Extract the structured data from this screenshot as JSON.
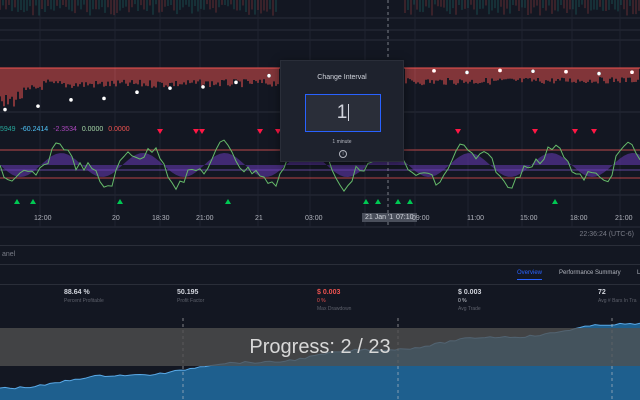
{
  "chart": {
    "indicator_values": [
      "5949",
      "-60.2414",
      "-2.3534",
      "0.0000",
      "0.0000"
    ],
    "indicator_colors": [
      "#26a69a",
      "#4fc3f7",
      "#ab47bc",
      "#a5d6a7",
      "#ef5350"
    ],
    "time_ticks": [
      {
        "label": "12:00",
        "highlight": false
      },
      {
        "label": "20",
        "highlight": false
      },
      {
        "label": "18:30",
        "highlight": false
      },
      {
        "label": "21:00",
        "highlight": false
      },
      {
        "label": "21",
        "highlight": false
      },
      {
        "label": "03:00",
        "highlight": false
      },
      {
        "label": "21 Jan '19",
        "highlight": true
      },
      {
        "label": "07:10",
        "highlight": true
      },
      {
        "label": "09:00",
        "highlight": false
      },
      {
        "label": "11:00",
        "highlight": false
      },
      {
        "label": "15:00",
        "highlight": false
      },
      {
        "label": "18:00",
        "highlight": false
      },
      {
        "label": "21:00",
        "highlight": false
      }
    ],
    "clock": "22:36:24 (UTC-6)",
    "colors": {
      "background": "#131722",
      "bull": "#26a69a",
      "bear": "#ef5350",
      "osc_line": "#66bb6a",
      "osc_fill": "#673ab7",
      "signal_up": "#00c853",
      "signal_down": "#ff1744"
    }
  },
  "dialog": {
    "title": "Change Interval",
    "value": "1",
    "hint": "1 minute",
    "info_icon": "info-icon",
    "info_glyph": "i"
  },
  "panel": {
    "label": "anel"
  },
  "tabs": [
    {
      "label": "Overview",
      "active": true
    },
    {
      "label": "Performance Summary",
      "active": false
    },
    {
      "label": "L",
      "active": false
    }
  ],
  "stats": [
    {
      "value": "88.64 %",
      "sub": "",
      "label": "Percent Profitable",
      "negative": false
    },
    {
      "value": "50.195",
      "sub": "",
      "label": "Profit Factor",
      "negative": false
    },
    {
      "value": "$ 0.003",
      "sub": "0 %",
      "label": "Max Drawdown",
      "negative": true
    },
    {
      "value": "$ 0.003",
      "sub": "0 %",
      "label": "Avg Trade",
      "negative": false
    },
    {
      "value": "72",
      "sub": "",
      "label": "Avg # Bars In Tra",
      "negative": false
    }
  ],
  "progress": {
    "text": "Progress: 2 / 23",
    "completed": 2,
    "total": 23
  }
}
